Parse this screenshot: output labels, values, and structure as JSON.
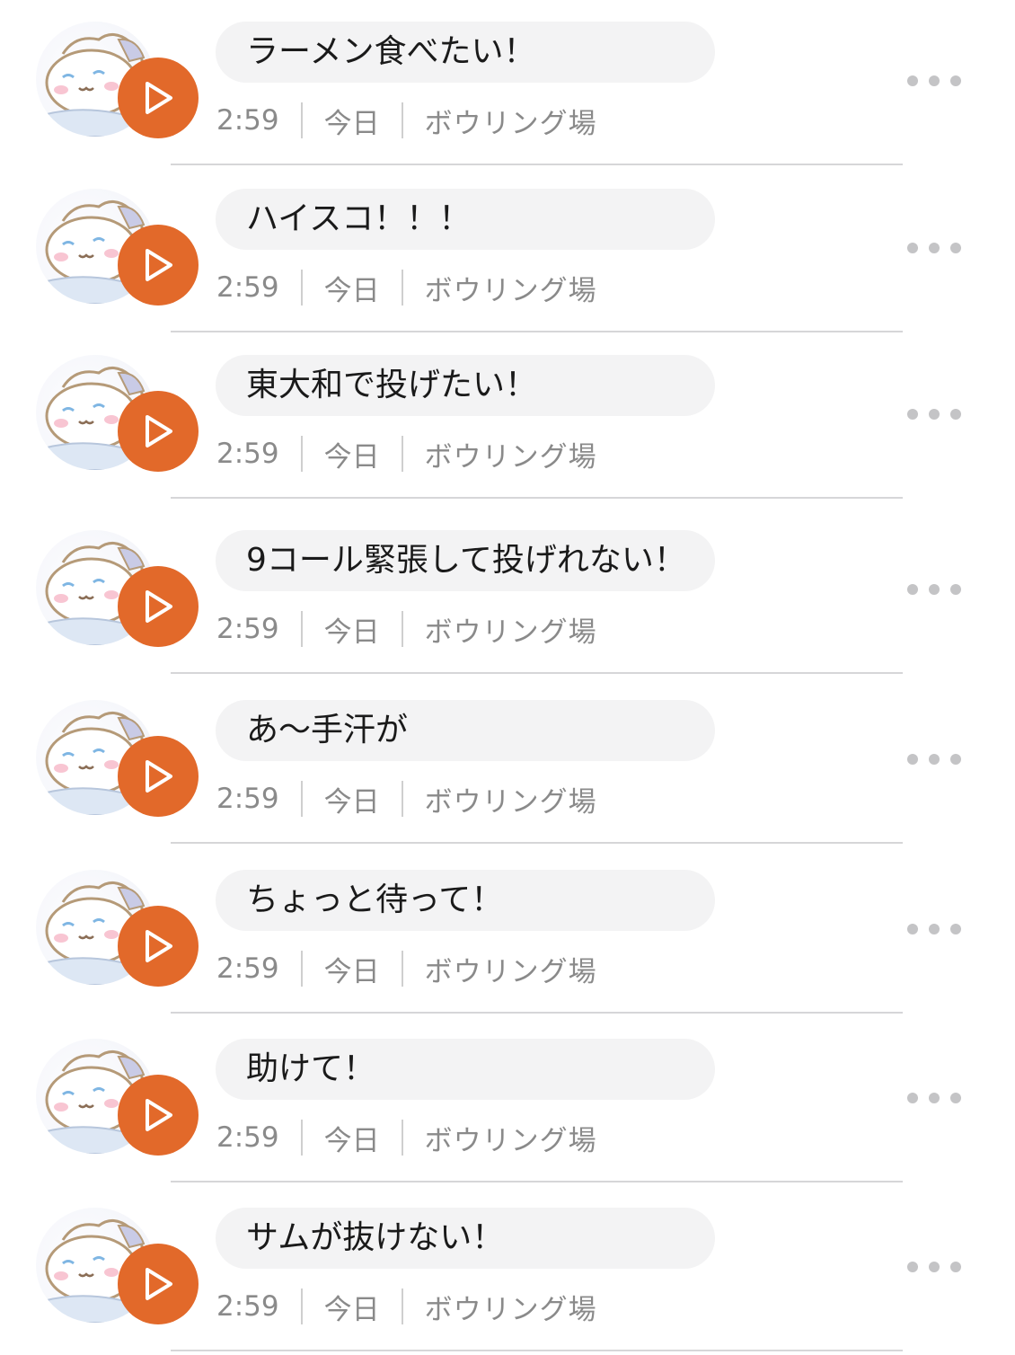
{
  "colors": {
    "accent": "#e2692a",
    "bubble_bg": "#f3f3f4",
    "meta_text": "#8a8a8a",
    "divider": "#d6d6d8"
  },
  "messages": [
    {
      "text": "ラーメン食べたい！",
      "duration": "2:59",
      "date": "今日",
      "location": "ボウリング場",
      "icon": "play-icon",
      "avatar": "cinnamoroll-avatar"
    },
    {
      "text": "ハイスコ！！！",
      "duration": "2:59",
      "date": "今日",
      "location": "ボウリング場",
      "icon": "play-icon",
      "avatar": "cinnamoroll-avatar"
    },
    {
      "text": "東大和で投げたい！",
      "duration": "2:59",
      "date": "今日",
      "location": "ボウリング場",
      "icon": "play-icon",
      "avatar": "cinnamoroll-avatar"
    },
    {
      "text": "9コール緊張して投げれない！",
      "duration": "2:59",
      "date": "今日",
      "location": "ボウリング場",
      "icon": "play-icon",
      "avatar": "cinnamoroll-avatar"
    },
    {
      "text": "あ～手汗が",
      "duration": "2:59",
      "date": "今日",
      "location": "ボウリング場",
      "icon": "play-icon",
      "avatar": "cinnamoroll-avatar"
    },
    {
      "text": "ちょっと待って！",
      "duration": "2:59",
      "date": "今日",
      "location": "ボウリング場",
      "icon": "play-icon",
      "avatar": "cinnamoroll-avatar"
    },
    {
      "text": "助けて！",
      "duration": "2:59",
      "date": "今日",
      "location": "ボウリング場",
      "icon": "play-icon",
      "avatar": "cinnamoroll-avatar"
    },
    {
      "text": "サムが抜けない！",
      "duration": "2:59",
      "date": "今日",
      "location": "ボウリング場",
      "icon": "play-icon",
      "avatar": "cinnamoroll-avatar"
    }
  ]
}
